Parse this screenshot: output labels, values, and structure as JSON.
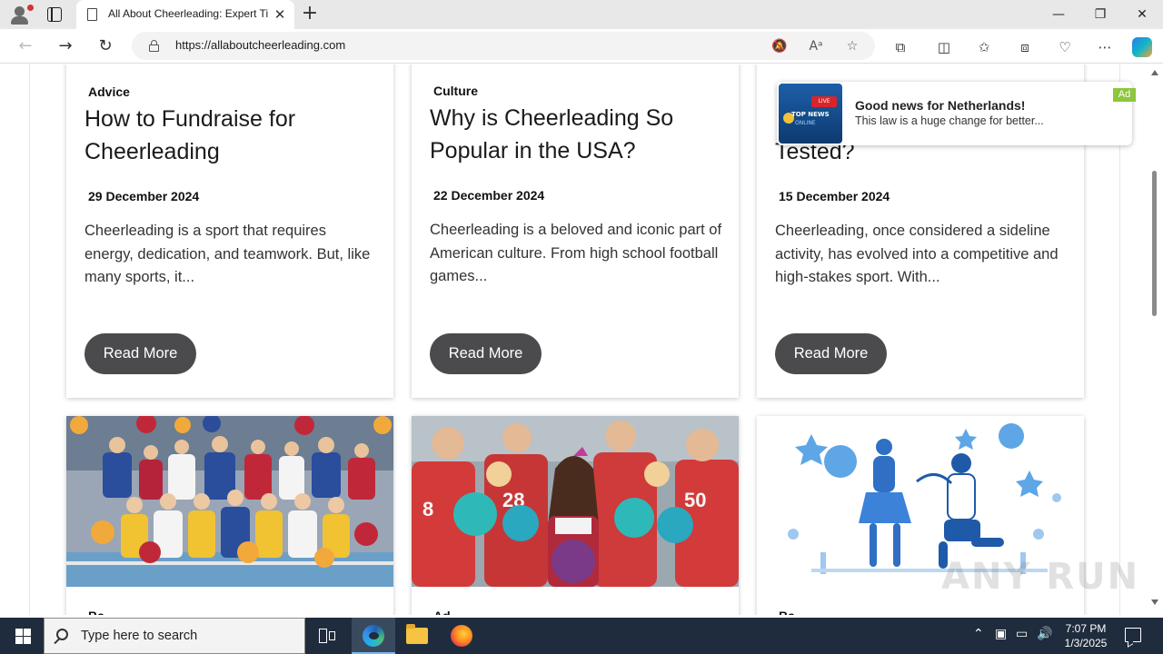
{
  "browser": {
    "tab_title": "All About Cheerleading: Expert Ti",
    "url": "https://allaboutcheerleading.com",
    "close_tab": "✕",
    "new_tab": "+",
    "window": {
      "minimize": "—",
      "restore": "❐",
      "close": "✕"
    }
  },
  "articles": [
    {
      "category": "Advice",
      "title": "How to Fundraise for Cheerleading",
      "date": "29 December 2024",
      "excerpt": "Cheerleading is a sport that requires energy, dedication, and teamwork. But, like many sports, it...",
      "button": "Read More"
    },
    {
      "category": "Culture",
      "title": "Why is Cheerleading So Popular in the USA?",
      "date": "22 December 2024",
      "excerpt": "Cheerleading is a beloved and iconic part of American culture. From high school football games...",
      "button": "Read More"
    },
    {
      "category": "",
      "title": "Tested?",
      "date": "15 December 2024",
      "excerpt": "Cheerleading, once considered a sideline activity, has evolved into a competitive and high-stakes sport. With...",
      "button": "Read More"
    }
  ],
  "image_cards": [
    {
      "image": "cheerleading-squad-photo",
      "category_peek": "Ba"
    },
    {
      "image": "cheerleaders-with-football-players-photo",
      "category_peek": "Ad"
    },
    {
      "image": "cheer-partners-illustration",
      "category_peek": "Ba"
    }
  ],
  "ad": {
    "headline": "Good news for Netherlands!",
    "subtext": "This law is a huge change for better...",
    "badge": "Ad",
    "thumb_live": "LIVE",
    "thumb_top": "TOP NEWS",
    "thumb_online": "ONLINE"
  },
  "watermark": "ANY RUN",
  "taskbar": {
    "search_placeholder": "Type here to search",
    "time": "7:07 PM",
    "date": "1/3/2025"
  },
  "colors": {
    "read_more_button": "#4b4b4e",
    "ad_badge": "#8dc63f",
    "taskbar": "#1f2c3d"
  }
}
